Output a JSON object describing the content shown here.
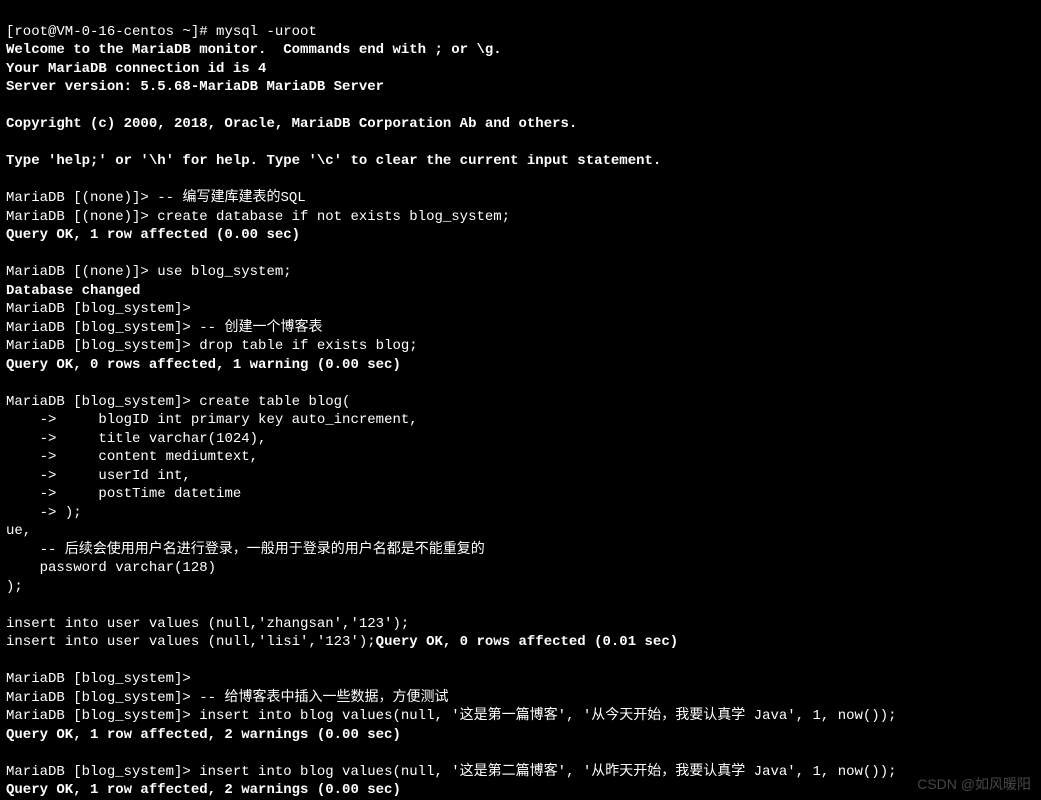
{
  "lines": {
    "l0": {
      "a": "[root@VM-0-16-centos ~]# ",
      "b": "mysql -uroot"
    },
    "l1": "Welcome to the MariaDB monitor.  Commands end with ; or \\g.",
    "l2": "Your MariaDB connection id is 4",
    "l3": "Server version: 5.5.68-MariaDB MariaDB Server",
    "l4": "Copyright (c) 2000, 2018, Oracle, MariaDB Corporation Ab and others.",
    "l5": "Type 'help;' or '\\h' for help. Type '\\c' to clear the current input statement.",
    "l6": {
      "a": "MariaDB [(none)]> ",
      "b": "-- 编写建库建表的SQL"
    },
    "l7": {
      "a": "MariaDB [(none)]> ",
      "b": "create database if not exists blog_system;"
    },
    "l8": "Query OK, 1 row affected (0.00 sec)",
    "l9": {
      "a": "MariaDB [(none)]> ",
      "b": "use blog_system;"
    },
    "l10": "Database changed",
    "l11": "MariaDB [blog_system]> ",
    "l12": {
      "a": "MariaDB [blog_system]> ",
      "b": "-- 创建一个博客表"
    },
    "l13": {
      "a": "MariaDB [blog_system]> ",
      "b": "drop table if exists blog;"
    },
    "l14": "Query OK, 0 rows affected, 1 warning (0.00 sec)",
    "l15": {
      "a": "MariaDB [blog_system]> ",
      "b": "create table blog("
    },
    "l16": {
      "a": "    ->     ",
      "b": "blogID int primary key auto_increment,"
    },
    "l17": {
      "a": "    ->     ",
      "b": "title varchar(1024),"
    },
    "l18": {
      "a": "    ->     ",
      "b": "content mediumtext,"
    },
    "l19": {
      "a": "    ->     ",
      "b": "userId int,"
    },
    "l20": {
      "a": "    ->     ",
      "b": "postTime datetime"
    },
    "l21": {
      "a": "    -> ",
      "b": ");"
    },
    "l22": "ue,",
    "l23": "    -- 后续会使用用户名进行登录，一般用于登录的用户名都是不能重复的",
    "l24": "    password varchar(128)",
    "l25": ");",
    "l26": "insert into user values (null,'zhangsan','123');",
    "l27": {
      "a": "insert into user values (null,'lisi','123');",
      "b": "Query OK, 0 rows affected (0.01 sec)"
    },
    "l28": "MariaDB [blog_system]> ",
    "l29": {
      "a": "MariaDB [blog_system]> ",
      "b": "-- 给博客表中插入一些数据，方便测试"
    },
    "l30": {
      "a": "MariaDB [blog_system]> ",
      "b": "insert into blog values(null, '这是第一篇博客', '从今天开始，我要认真学 Java', 1, now());"
    },
    "l31": "Query OK, 1 row affected, 2 warnings (0.00 sec)",
    "l32": {
      "a": "MariaDB [blog_system]> ",
      "b": "insert into blog values(null, '这是第二篇博客', '从昨天开始，我要认真学 Java', 1, now());"
    },
    "l33": "Query OK, 1 row affected, 2 warnings (0.00 sec)"
  },
  "watermark": "CSDN @如风暖阳"
}
